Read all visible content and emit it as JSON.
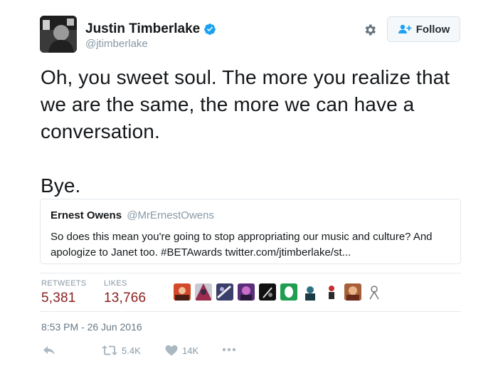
{
  "author": {
    "name": "Justin Timberlake",
    "handle": "@jtimberlake",
    "avatar_icon": "avatar-photo",
    "verified_icon": "verified-badge-icon"
  },
  "header_actions": {
    "gear_icon": "gear-icon",
    "follow_label": "Follow"
  },
  "tweet": {
    "lines": [
      "Oh, you sweet soul. The more you realize that",
      "we are the same, the more we can have a",
      "conversation."
    ],
    "closing": "Bye."
  },
  "quoted_tweet": {
    "name": "Ernest Owens",
    "handle": "@MrErnestOwens",
    "text_line1": "So does this mean you're going to stop appropriating our music and culture? And",
    "text_line2": "apologize to Janet too. #BETAwards twitter.com/jtimberlake/st..."
  },
  "stats": {
    "retweets_label": "RETWEETS",
    "retweets_value": "5,381",
    "likes_label": "LIKES",
    "likes_value": "13,766",
    "value_color": "#8a1f1f"
  },
  "timestamp": "8:53 PM - 26 Jun 2016",
  "actions": {
    "reply_icon": "reply-icon",
    "retweet_icon": "retweet-icon",
    "retweet_count": "5.4K",
    "like_icon": "heart-icon",
    "like_count": "14K",
    "more_icon": "more-dots-icon"
  },
  "colors": {
    "accent": "#1da1f2",
    "muted": "#8899a6"
  }
}
